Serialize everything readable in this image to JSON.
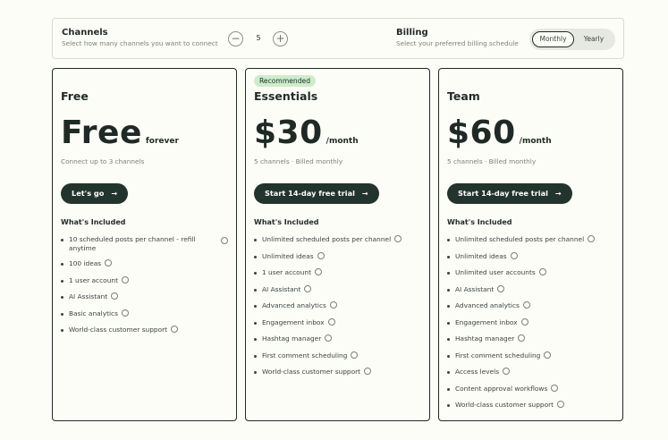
{
  "channels": {
    "title": "Channels",
    "subtitle": "Select how many channels you want to connect",
    "minus_symbol": "−",
    "plus_symbol": "+",
    "value": "5"
  },
  "billing": {
    "title": "Billing",
    "subtitle": "Select your preferred billing schedule",
    "options": [
      "Monthly",
      "Yearly"
    ],
    "selected": "Monthly"
  },
  "plans": [
    {
      "name": "Free",
      "badge": "",
      "price": "Free",
      "unit": "forever",
      "description": "Connect up to 3 channels",
      "cta": "Let's go",
      "included_label": "What's Included",
      "features": [
        "10 scheduled posts per channel - refill anytime",
        "100 ideas",
        "1 user account",
        "AI Assistant",
        "Basic analytics",
        "World-class customer support"
      ]
    },
    {
      "name": "Essentials",
      "badge": "Recommended",
      "price": "$30",
      "unit": "/month",
      "description": "5 channels · Billed monthly",
      "cta": "Start 14-day free trial",
      "included_label": "What's Included",
      "features": [
        "Unlimited scheduled posts per channel",
        "Unlimited ideas",
        "1 user account",
        "AI Assistant",
        "Advanced analytics",
        "Engagement inbox",
        "Hashtag manager",
        "First comment scheduling",
        "World-class customer support"
      ]
    },
    {
      "name": "Team",
      "badge": "",
      "price": "$60",
      "unit": "/month",
      "description": "5 channels · Billed monthly",
      "cta": "Start 14-day free trial",
      "included_label": "What's Included",
      "features": [
        "Unlimited scheduled posts per channel",
        "Unlimited ideas",
        "Unlimited user accounts",
        "AI Assistant",
        "Advanced analytics",
        "Engagement inbox",
        "Hashtag manager",
        "First comment scheduling",
        "Access levels",
        "Content approval workflows",
        "World-class customer support"
      ]
    }
  ],
  "icons": {
    "cta_arrow": "arrow-right-icon",
    "feature_info": "info-circle-icon",
    "feature_bullet": "bullet-dot-icon"
  },
  "colors": {
    "primary_dark": "#23332d",
    "badge_green": "#cdeccb",
    "background": "#fdfdf8"
  }
}
